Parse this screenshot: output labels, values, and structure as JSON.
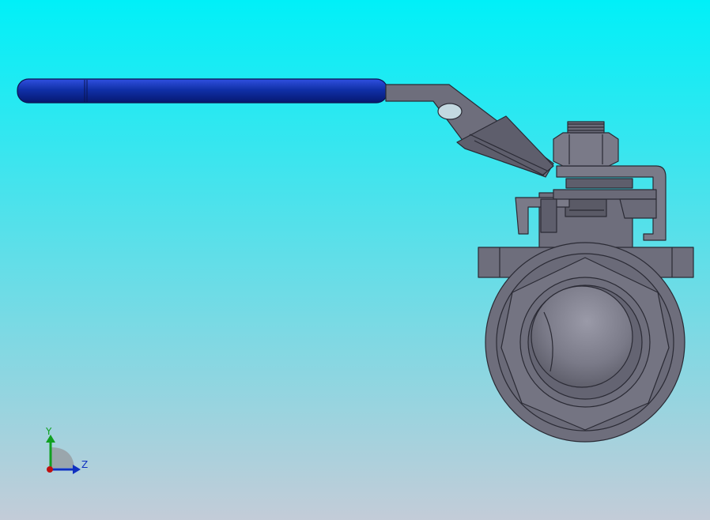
{
  "viewport": {
    "background_top": "#00f0f8",
    "background_bottom": "#c3ccd8"
  },
  "model": {
    "body_color": "#6e6e7c",
    "edge_color": "#2a2a34",
    "handle_grip_color": "#1030a0"
  },
  "triad": {
    "y_label": "Y",
    "z_label": "Z",
    "y_color": "#10a020",
    "z_color": "#1030c0",
    "x_color": "#c01010"
  }
}
